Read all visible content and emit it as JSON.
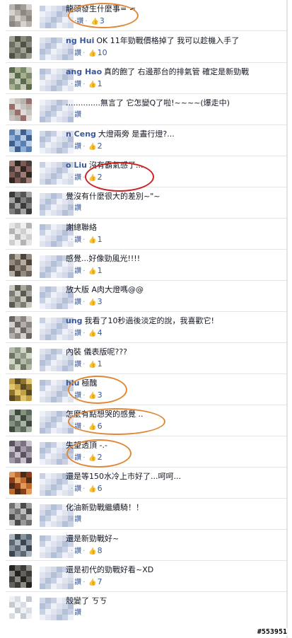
{
  "comments": [
    {
      "name": "",
      "text": "龍頭發生什麼事= =",
      "actions": "‧讚",
      "likes": "3",
      "avatar_colors": [
        "#b9b3ae",
        "#d6d2cf",
        "#a39d98",
        "#8c8781"
      ]
    },
    {
      "name": "ng Hui",
      "text": "OK 11年勁戰價格掉了 我可以趁機入手了",
      "actions": "讚",
      "likes": "10",
      "avatar_colors": [
        "#6b6e63",
        "#888a7c",
        "#4f5247",
        "#9fa193"
      ]
    },
    {
      "name": "ang Hao",
      "text": "真的飽了 右邊那台的排氣管 確定是新勁戰",
      "actions": "讚",
      "likes": "1",
      "avatar_colors": [
        "#7b8a6a",
        "#a6b08f",
        "#5c6b4e",
        "#c2c7b6"
      ]
    },
    {
      "name": "",
      "text": "..............無言了 它怎變Q了啦!~~~~(爆走中)",
      "actions": "讚",
      "likes": "",
      "avatar_colors": [
        "#c7c3c0",
        "#e0dbd6",
        "#9a6d6d",
        "#b8b2ad"
      ]
    },
    {
      "name": "n Ceng",
      "text": "大燈兩旁 是晝行燈?...",
      "actions": "讚",
      "likes": "2",
      "avatar_colors": [
        "#5a7fb3",
        "#8fb0d8",
        "#3f5f8f",
        "#b7cbe3"
      ]
    },
    {
      "name": "o Liu",
      "text": "沒有霸氣感了...",
      "actions": "讚",
      "likes": "2",
      "avatar_colors": [
        "#4a3b38",
        "#7a5a52",
        "#2f2624",
        "#9b7d73"
      ]
    },
    {
      "name": "",
      "text": "覺沒有什麼很大的差別~\"~",
      "actions": "讚",
      "likes": "",
      "avatar_colors": [
        "#545454",
        "#7f7f7f",
        "#3a3a3a",
        "#a3a3a3"
      ]
    },
    {
      "name": "",
      "text": "謝總聯絡",
      "actions": "讚",
      "likes": "1",
      "avatar_colors": [
        "#cfcfcf",
        "#e6e6e6",
        "#b4b4b4",
        "#f0f0f0"
      ]
    },
    {
      "name": "",
      "text": "感覺...好像勁風光!!!!",
      "actions": "讚",
      "likes": "1",
      "avatar_colors": [
        "#6d6257",
        "#958a7f",
        "#4c443b",
        "#b5ab9f"
      ]
    },
    {
      "name": "",
      "text": "放大版 A肉大燈嗎@@",
      "actions": "讚",
      "likes": "3",
      "avatar_colors": [
        "#7c7c74",
        "#a8a89e",
        "#5a5a53",
        "#c9c9c0"
      ]
    },
    {
      "name": "ung",
      "text": "我看了10秒過後淡定的說，我喜歡它!",
      "actions": "讚",
      "likes": "4",
      "avatar_colors": [
        "#8a8580",
        "#b3aea9",
        "#6a6560",
        "#d3cfca"
      ]
    },
    {
      "name": "",
      "text": "內裝 儀表版呢???",
      "actions": "讚",
      "likes": "1",
      "avatar_colors": [
        "#8e9783",
        "#b3bba8",
        "#6e7663",
        "#d0d6c6"
      ]
    },
    {
      "name": "hiu",
      "text": "極醜",
      "actions": "讚",
      "likes": "3",
      "avatar_colors": [
        "#c2a048",
        "#e0c56d",
        "#8f7330",
        "#5a4a22"
      ]
    },
    {
      "name": "",
      "text": "怎麼有點想哭的感覺 ..",
      "actions": "讚",
      "likes": "6",
      "avatar_colors": [
        "#5d6b5f",
        "#84917f",
        "#3e4a40",
        "#a9b4a6"
      ]
    },
    {
      "name": "",
      "text": "失望透頂 -.-",
      "actions": "讚",
      "likes": "2",
      "avatar_colors": [
        "#7a7280",
        "#a39ca8",
        "#5a5360",
        "#c7c1cb"
      ]
    },
    {
      "name": "",
      "text": "還是等150水冷上市好了...呵呵...",
      "actions": "讚",
      "likes": "6",
      "avatar_colors": [
        "#c06a2e",
        "#e29a5a",
        "#8a3f18",
        "#4a2a18"
      ]
    },
    {
      "name": "",
      "text": "化油新勁戰繼續騎！！",
      "actions": "讚",
      "likes": "",
      "avatar_colors": [
        "#6f6f6f",
        "#9a9a9a",
        "#4a4a4a",
        "#bdbdbd"
      ]
    },
    {
      "name": "",
      "text": "還是新勁戰好~",
      "actions": "讚",
      "likes": "8",
      "avatar_colors": [
        "#5b6772",
        "#86929d",
        "#3c4650",
        "#aab4bd"
      ]
    },
    {
      "name": "",
      "text": "還是初代的勁戰好看~XD",
      "actions": "讚",
      "likes": "7",
      "avatar_colors": [
        "#3b3a38",
        "#65625d",
        "#24231f",
        "#8c8882"
      ]
    },
    {
      "name": "",
      "text": "殼變了 ㄎㄎ",
      "actions": "讚",
      "likes": "",
      "avatar_colors": [
        "#d8dde3",
        "#eef1f4",
        "#c3cad2",
        "#ffffff"
      ]
    }
  ],
  "watermark": "#553951",
  "ui": {
    "separator": "‧",
    "like_icon": "thumbs-up-icon",
    "highlight_color": "#e08838",
    "highlight_red": "#cc2222",
    "link_color": "#3b5998"
  }
}
